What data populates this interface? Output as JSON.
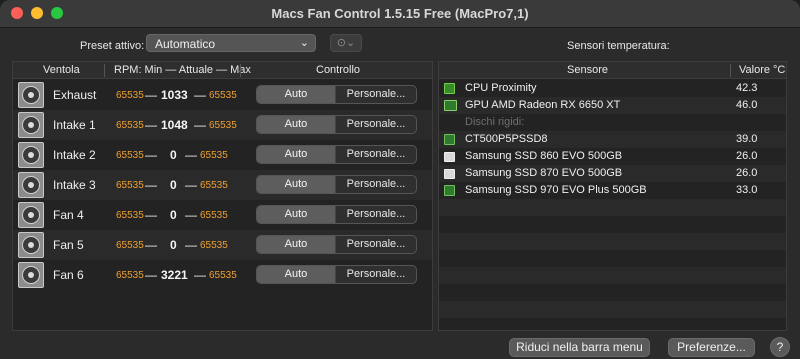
{
  "window": {
    "title": "Macs Fan Control 1.5.15 Free (MacPro7,1)"
  },
  "toolbar": {
    "preset_label": "Preset attivo:",
    "preset_value": "Automatico",
    "sensors_title": "Sensori temperatura:",
    "options_icon": "ellipsis-circle-icon"
  },
  "fan_table": {
    "headers": {
      "fan": "Ventola",
      "rpm": "RPM: Min — Attuale — Max",
      "control": "Controllo"
    },
    "auto_label": "Auto",
    "custom_label": "Personale...",
    "dash": "—",
    "rows": [
      {
        "name": "Exhaust",
        "min": "65535",
        "current": "1033",
        "max": "65535"
      },
      {
        "name": "Intake 1",
        "min": "65535",
        "current": "1048",
        "max": "65535"
      },
      {
        "name": "Intake 2",
        "min": "65535",
        "current": "0",
        "max": "65535"
      },
      {
        "name": "Intake 3",
        "min": "65535",
        "current": "0",
        "max": "65535"
      },
      {
        "name": "Fan 4",
        "min": "65535",
        "current": "0",
        "max": "65535"
      },
      {
        "name": "Fan 5",
        "min": "65535",
        "current": "0",
        "max": "65535"
      },
      {
        "name": "Fan 6",
        "min": "65535",
        "current": "3221",
        "max": "65535"
      }
    ]
  },
  "sensor_table": {
    "headers": {
      "sensor": "Sensore",
      "value": "Valore °C"
    },
    "rows": [
      {
        "name": "CPU Proximity",
        "value": "42.3",
        "icon": "cpu-chip-icon"
      },
      {
        "name": "GPU AMD Radeon RX 6650 XT",
        "value": "46.0",
        "icon": "gpu-icon"
      },
      {
        "name": "Dischi rigidi:",
        "value": "",
        "icon": "",
        "group": true
      },
      {
        "name": "CT500P5PSSD8",
        "value": "39.0",
        "icon": "ssd-chip-icon"
      },
      {
        "name": "Samsung SSD 860 EVO 500GB",
        "value": "26.0",
        "icon": "disk-drive-icon"
      },
      {
        "name": "Samsung SSD 870 EVO 500GB",
        "value": "26.0",
        "icon": "disk-drive-icon"
      },
      {
        "name": "Samsung SSD 970 EVO Plus 500GB",
        "value": "33.0",
        "icon": "ssd-chip-icon"
      }
    ]
  },
  "footer": {
    "tray_button": "Riduci nella barra menu",
    "prefs_button": "Preferenze...",
    "help_button": "?"
  },
  "colors": {
    "rpm_limit": "#f0a030",
    "close": "#fe5f57",
    "minimize": "#febc2e",
    "maximize": "#28c840"
  }
}
